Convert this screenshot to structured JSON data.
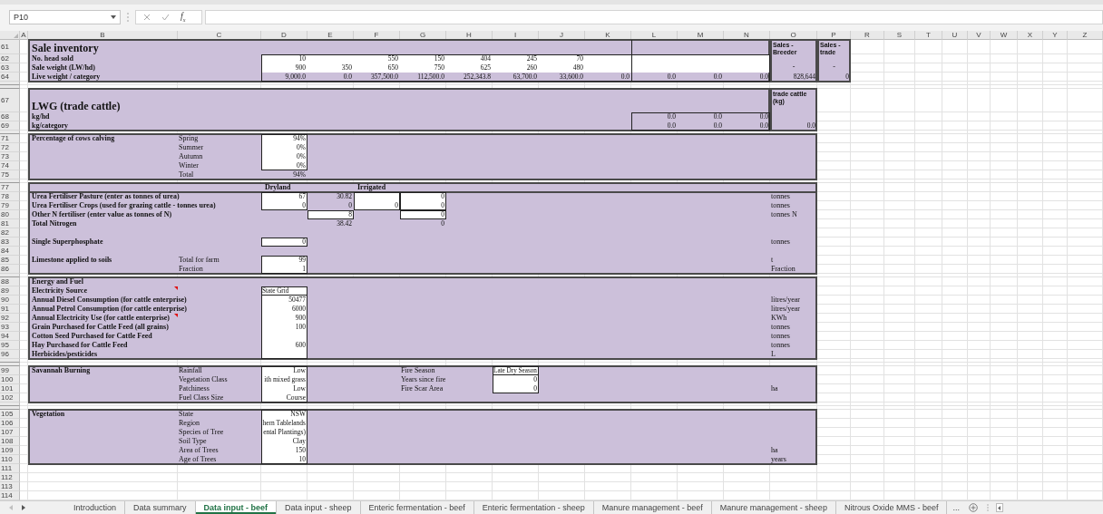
{
  "formula_bar": {
    "name_box": "P10",
    "function_label": "f$_{x}$"
  },
  "columns": [
    "A",
    "B",
    "C",
    "D",
    "E",
    "F",
    "G",
    "H",
    "I",
    "J",
    "K",
    "L",
    "M",
    "N",
    "O",
    "P",
    "R",
    "S",
    "T",
    "U",
    "V",
    "W",
    "X",
    "Y",
    "Z"
  ],
  "rows": [
    {
      "number": "61",
      "hidden": false,
      "cells": {
        "B": {
          "kind": "heading",
          "text": "Sale inventory",
          "comment": false
        },
        "O": {
          "kind": "note",
          "text": "Sales - Breeder",
          "comment": false
        },
        "P": {
          "kind": "note",
          "text": "Sales - trade",
          "comment": false
        }
      }
    },
    {
      "number": "62",
      "hidden": false,
      "cells": {
        "B": {
          "kind": "label",
          "text": "No. head sold",
          "comment": false
        },
        "D": {
          "kind": "value",
          "text": "10",
          "comment": false
        },
        "F": {
          "kind": "value",
          "text": "550",
          "comment": false
        },
        "G": {
          "kind": "value",
          "text": "150",
          "comment": false
        },
        "H": {
          "kind": "value",
          "text": "404",
          "comment": false
        },
        "I": {
          "kind": "value",
          "text": "245",
          "comment": false
        },
        "J": {
          "kind": "value",
          "text": "70",
          "comment": false
        }
      }
    },
    {
      "number": "63",
      "hidden": false,
      "cells": {
        "B": {
          "kind": "label",
          "text": "Sale weight (LW/hd)",
          "comment": false
        },
        "D": {
          "kind": "value",
          "text": "900",
          "comment": false
        },
        "E": {
          "kind": "value",
          "text": "350",
          "comment": false
        },
        "F": {
          "kind": "value",
          "text": "650",
          "comment": false
        },
        "G": {
          "kind": "value",
          "text": "750",
          "comment": false
        },
        "H": {
          "kind": "value",
          "text": "625",
          "comment": false
        },
        "I": {
          "kind": "value",
          "text": "260",
          "comment": false
        },
        "J": {
          "kind": "value",
          "text": "480",
          "comment": false
        },
        "O": {
          "kind": "mark",
          "text": "-",
          "comment": false
        },
        "P": {
          "kind": "mark",
          "text": "-",
          "comment": false
        }
      }
    },
    {
      "number": "64",
      "hidden": false,
      "cells": {
        "B": {
          "kind": "label",
          "text": "Live weight / category",
          "comment": false
        },
        "D": {
          "kind": "value",
          "text": "9,000.0",
          "comment": false
        },
        "E": {
          "kind": "value",
          "text": "0.0",
          "comment": false
        },
        "F": {
          "kind": "value",
          "text": "357,500.0",
          "comment": false
        },
        "G": {
          "kind": "value",
          "text": "112,500.0",
          "comment": false
        },
        "H": {
          "kind": "value",
          "text": "252,343.8",
          "comment": false
        },
        "I": {
          "kind": "value",
          "text": "63,700.0",
          "comment": false
        },
        "J": {
          "kind": "value",
          "text": "33,600.0",
          "comment": false
        },
        "K": {
          "kind": "value",
          "text": "0.0",
          "comment": false
        },
        "L": {
          "kind": "value",
          "text": "0.0",
          "comment": false
        },
        "M": {
          "kind": "value",
          "text": "0.0",
          "comment": false
        },
        "N": {
          "kind": "value",
          "text": "0.0",
          "comment": false
        },
        "O": {
          "kind": "value",
          "text": "828,644",
          "comment": false
        },
        "P": {
          "kind": "value",
          "text": "0",
          "comment": false
        }
      }
    },
    {
      "hidden": true,
      "cells": {}
    },
    {
      "hidden": true,
      "cells": {}
    },
    {
      "number": "67",
      "hidden": false,
      "cells": {
        "B": {
          "kind": "heading",
          "text": "LWG (trade cattle)",
          "comment": false
        },
        "O": {
          "kind": "note",
          "text": "trade cattle (kg)",
          "comment": false
        }
      }
    },
    {
      "number": "68",
      "hidden": false,
      "cells": {
        "B": {
          "kind": "label",
          "text": "kg/hd",
          "comment": false
        },
        "L": {
          "kind": "value",
          "text": "0.0",
          "comment": false
        },
        "M": {
          "kind": "value",
          "text": "0.0",
          "comment": false
        },
        "N": {
          "kind": "value",
          "text": "0.0",
          "comment": false
        }
      }
    },
    {
      "number": "69",
      "hidden": false,
      "cells": {
        "B": {
          "kind": "label",
          "text": "kg/category",
          "comment": false
        },
        "L": {
          "kind": "value",
          "text": "0.0",
          "comment": false
        },
        "M": {
          "kind": "value",
          "text": "0.0",
          "comment": false
        },
        "N": {
          "kind": "value",
          "text": "0.0",
          "comment": false
        },
        "O": {
          "kind": "value",
          "text": "0.0",
          "comment": false
        }
      }
    },
    {
      "hidden": true,
      "cells": {}
    },
    {
      "number": "71",
      "hidden": false,
      "cells": {
        "B": {
          "kind": "label",
          "text": "Percentage of cows calving",
          "comment": false
        },
        "C": {
          "kind": "text",
          "text": "Spring",
          "comment": false
        },
        "D": {
          "kind": "value",
          "text": "94%",
          "comment": false
        }
      }
    },
    {
      "number": "72",
      "hidden": false,
      "cells": {
        "C": {
          "kind": "text",
          "text": "Summer",
          "comment": false
        },
        "D": {
          "kind": "value",
          "text": "0%",
          "comment": false
        }
      }
    },
    {
      "number": "73",
      "hidden": false,
      "cells": {
        "C": {
          "kind": "text",
          "text": "Autumn",
          "comment": false
        },
        "D": {
          "kind": "value",
          "text": "0%",
          "comment": false
        }
      }
    },
    {
      "number": "74",
      "hidden": false,
      "cells": {
        "C": {
          "kind": "text",
          "text": "Winter",
          "comment": false
        },
        "D": {
          "kind": "value",
          "text": "0%",
          "comment": false
        }
      }
    },
    {
      "number": "75",
      "hidden": false,
      "cells": {
        "C": {
          "kind": "text",
          "text": "Total",
          "comment": false
        },
        "D": {
          "kind": "value",
          "text": "94%",
          "comment": false
        }
      }
    },
    {
      "hidden": true,
      "cells": {}
    },
    {
      "number": "77",
      "hidden": false,
      "cells": {
        "D": {
          "kind": "label",
          "text": "Dryland",
          "comment": false
        },
        "F": {
          "kind": "label",
          "text": "Irrigated",
          "comment": false
        }
      }
    },
    {
      "number": "78",
      "hidden": false,
      "cells": {
        "B": {
          "kind": "label",
          "text": "Urea Fertiliser Pasture (enter as tonnes of urea)",
          "comment": false
        },
        "D": {
          "kind": "value",
          "text": "67",
          "comment": false
        },
        "E": {
          "kind": "value",
          "text": "30.82",
          "comment": false
        },
        "G": {
          "kind": "value",
          "text": "0",
          "comment": false
        },
        "O": {
          "kind": "text",
          "text": "tonnes",
          "comment": false
        }
      }
    },
    {
      "number": "79",
      "hidden": false,
      "cells": {
        "B": {
          "kind": "label",
          "text": "Urea Fertiliser Crops (used for grazing cattle - tonnes urea)",
          "comment": false
        },
        "D": {
          "kind": "value",
          "text": "0",
          "comment": false
        },
        "E": {
          "kind": "value",
          "text": "0",
          "comment": false
        },
        "F": {
          "kind": "value",
          "text": "0",
          "comment": false
        },
        "G": {
          "kind": "value",
          "text": "0",
          "comment": false
        },
        "O": {
          "kind": "text",
          "text": "tonnes",
          "comment": false
        }
      }
    },
    {
      "number": "80",
      "hidden": false,
      "cells": {
        "B": {
          "kind": "label",
          "text": "Other N fertiliser (enter value as tonnes of N)",
          "comment": false
        },
        "E": {
          "kind": "value",
          "text": "8",
          "comment": false
        },
        "G": {
          "kind": "value",
          "text": "0",
          "comment": false
        },
        "O": {
          "kind": "text",
          "text": "tonnes N",
          "comment": false
        }
      }
    },
    {
      "number": "81",
      "hidden": false,
      "cells": {
        "B": {
          "kind": "label",
          "text": "Total Nitrogen",
          "comment": false
        },
        "E": {
          "kind": "value",
          "text": "38.42",
          "comment": false
        },
        "G": {
          "kind": "value",
          "text": "0",
          "comment": false
        }
      }
    },
    {
      "number": "82",
      "hidden": false,
      "cells": {}
    },
    {
      "number": "83",
      "hidden": false,
      "cells": {
        "B": {
          "kind": "label",
          "text": "Single Superphosphate",
          "comment": false
        },
        "D": {
          "kind": "value",
          "text": "0",
          "comment": false
        },
        "O": {
          "kind": "text",
          "text": "tonnes",
          "comment": false
        }
      }
    },
    {
      "number": "84",
      "hidden": false,
      "cells": {}
    },
    {
      "number": "85",
      "hidden": false,
      "cells": {
        "B": {
          "kind": "label",
          "text": "Limestone applied to soils",
          "comment": false
        },
        "C": {
          "kind": "text",
          "text": "Total for farm",
          "comment": false
        },
        "D": {
          "kind": "value",
          "text": "99",
          "comment": false
        },
        "O": {
          "kind": "text",
          "text": "t",
          "comment": false
        }
      }
    },
    {
      "number": "86",
      "hidden": false,
      "cells": {
        "C": {
          "kind": "text",
          "text": "Fraction",
          "comment": false
        },
        "D": {
          "kind": "value",
          "text": "1",
          "comment": false
        },
        "O": {
          "kind": "text",
          "text": "Fraction",
          "comment": false
        }
      }
    },
    {
      "hidden": true,
      "cells": {}
    },
    {
      "number": "88",
      "hidden": false,
      "cells": {
        "B": {
          "kind": "label",
          "text": "Energy and Fuel",
          "comment": false
        }
      }
    },
    {
      "number": "89",
      "hidden": false,
      "cells": {
        "B": {
          "kind": "label",
          "text": "Electricity Source",
          "comment": true
        },
        "D": {
          "kind": "value_left",
          "text": "State Grid",
          "comment": false
        }
      }
    },
    {
      "number": "90",
      "hidden": false,
      "cells": {
        "B": {
          "kind": "label",
          "text": "Annual Diesel Consumption (for cattle enterprise)",
          "comment": false
        },
        "D": {
          "kind": "value",
          "text": "50477",
          "comment": false
        },
        "O": {
          "kind": "text",
          "text": "litres/year",
          "comment": false
        }
      }
    },
    {
      "number": "91",
      "hidden": false,
      "cells": {
        "B": {
          "kind": "label",
          "text": "Annual Petrol Consumption (for cattle enterprise)",
          "comment": false
        },
        "D": {
          "kind": "value",
          "text": "6000",
          "comment": false
        },
        "O": {
          "kind": "text",
          "text": "litres/year",
          "comment": false
        }
      }
    },
    {
      "number": "92",
      "hidden": false,
      "cells": {
        "B": {
          "kind": "label",
          "text": "Annual Electricity Use (for cattle enterprise)",
          "comment": true
        },
        "D": {
          "kind": "value",
          "text": "900",
          "comment": false
        },
        "O": {
          "kind": "text",
          "text": "KWh",
          "comment": false
        }
      }
    },
    {
      "number": "93",
      "hidden": false,
      "cells": {
        "B": {
          "kind": "label",
          "text": "Grain Purchased for Cattle Feed (all grains)",
          "comment": false
        },
        "D": {
          "kind": "value",
          "text": "100",
          "comment": false
        },
        "O": {
          "kind": "text",
          "text": "tonnes",
          "comment": false
        }
      }
    },
    {
      "number": "94",
      "hidden": false,
      "cells": {
        "B": {
          "kind": "label",
          "text": "Cotton Seed Purchased for Cattle Feed",
          "comment": false
        },
        "O": {
          "kind": "text",
          "text": "tonnes",
          "comment": false
        }
      }
    },
    {
      "number": "95",
      "hidden": false,
      "cells": {
        "B": {
          "kind": "label",
          "text": "Hay Purchased for Cattle Feed",
          "comment": false
        },
        "D": {
          "kind": "value",
          "text": "600",
          "comment": false
        },
        "O": {
          "kind": "text",
          "text": "tonnes",
          "comment": false
        }
      }
    },
    {
      "number": "96",
      "hidden": false,
      "cells": {
        "B": {
          "kind": "label",
          "text": "Herbicides/pesticides",
          "comment": false
        },
        "O": {
          "kind": "text",
          "text": "L",
          "comment": false
        }
      }
    },
    {
      "hidden": true,
      "cells": {}
    },
    {
      "hidden": true,
      "cells": {}
    },
    {
      "number": "99",
      "hidden": false,
      "cells": {
        "B": {
          "kind": "label",
          "text": "Savannah Burning",
          "comment": false
        },
        "C": {
          "kind": "text",
          "text": "Rainfall",
          "comment": false
        },
        "D": {
          "kind": "value",
          "text": "Low",
          "comment": false
        },
        "G": {
          "kind": "text",
          "text": "Fire Season",
          "comment": false
        },
        "I": {
          "kind": "value_left",
          "text": "Late Dry Season",
          "comment": false
        }
      }
    },
    {
      "number": "100",
      "hidden": false,
      "cells": {
        "C": {
          "kind": "text",
          "text": "Vegetation Class",
          "comment": false
        },
        "D": {
          "kind": "value",
          "text": "ith mixed grass",
          "comment": false
        },
        "G": {
          "kind": "text",
          "text": "Years since fire",
          "comment": false
        },
        "I": {
          "kind": "value",
          "text": "0",
          "comment": false
        }
      }
    },
    {
      "number": "101",
      "hidden": false,
      "cells": {
        "C": {
          "kind": "text",
          "text": "Patchiness",
          "comment": false
        },
        "D": {
          "kind": "value",
          "text": "Low",
          "comment": false
        },
        "G": {
          "kind": "text",
          "text": "Fire Scar Area",
          "comment": false
        },
        "I": {
          "kind": "value",
          "text": "0",
          "comment": false
        },
        "O": {
          "kind": "text",
          "text": "ha",
          "comment": false
        }
      }
    },
    {
      "number": "102",
      "hidden": false,
      "cells": {
        "C": {
          "kind": "text",
          "text": "Fuel Class Size",
          "comment": false
        },
        "D": {
          "kind": "value",
          "text": "Course",
          "comment": false
        }
      }
    },
    {
      "hidden": true,
      "cells": {}
    },
    {
      "hidden": true,
      "cells": {}
    },
    {
      "number": "105",
      "hidden": false,
      "cells": {
        "B": {
          "kind": "label",
          "text": "Vegetation",
          "comment": false
        },
        "C": {
          "kind": "text",
          "text": "State",
          "comment": false
        },
        "D": {
          "kind": "value",
          "text": "NSW",
          "comment": false
        }
      }
    },
    {
      "number": "106",
      "hidden": false,
      "cells": {
        "C": {
          "kind": "text",
          "text": "Region",
          "comment": false
        },
        "D": {
          "kind": "value",
          "text": "hern Tablelands",
          "comment": false
        }
      }
    },
    {
      "number": "107",
      "hidden": false,
      "cells": {
        "C": {
          "kind": "text",
          "text": "Species of Tree",
          "comment": false
        },
        "D": {
          "kind": "value",
          "text": "ental Plantings)",
          "comment": false
        }
      }
    },
    {
      "number": "108",
      "hidden": false,
      "cells": {
        "C": {
          "kind": "text",
          "text": "Soil Type",
          "comment": false
        },
        "D": {
          "kind": "value",
          "text": "Clay",
          "comment": false
        }
      }
    },
    {
      "number": "109",
      "hidden": false,
      "cells": {
        "C": {
          "kind": "text",
          "text": "Area of Trees",
          "comment": false
        },
        "D": {
          "kind": "value",
          "text": "150",
          "comment": false
        },
        "O": {
          "kind": "text",
          "text": "ha",
          "comment": false
        }
      }
    },
    {
      "number": "110",
      "hidden": false,
      "cells": {
        "C": {
          "kind": "text",
          "text": "Age of Trees",
          "comment": false
        },
        "D": {
          "kind": "value",
          "text": "10",
          "comment": false
        },
        "O": {
          "kind": "text",
          "text": "years",
          "comment": false
        }
      }
    },
    {
      "number": "111",
      "hidden": false,
      "cells": {}
    },
    {
      "number": "112",
      "hidden": false,
      "cells": {}
    },
    {
      "number": "113",
      "hidden": false,
      "cells": {}
    },
    {
      "number": "114",
      "hidden": false,
      "cells": {}
    }
  ],
  "sheet_tabs": [
    {
      "label": "Introduction",
      "selected": false
    },
    {
      "label": "Data summary",
      "selected": false
    },
    {
      "label": "Data input - beef",
      "selected": true
    },
    {
      "label": "Data input - sheep",
      "selected": false
    },
    {
      "label": "Enteric fermentation - beef",
      "selected": false
    },
    {
      "label": "Enteric fermentation - sheep",
      "selected": false
    },
    {
      "label": "Manure management - beef",
      "selected": false
    },
    {
      "label": "Manure management - sheep",
      "selected": false
    },
    {
      "label": "Nitrous Oxide MMS - beef",
      "selected": false
    }
  ],
  "more_tabs": "..."
}
